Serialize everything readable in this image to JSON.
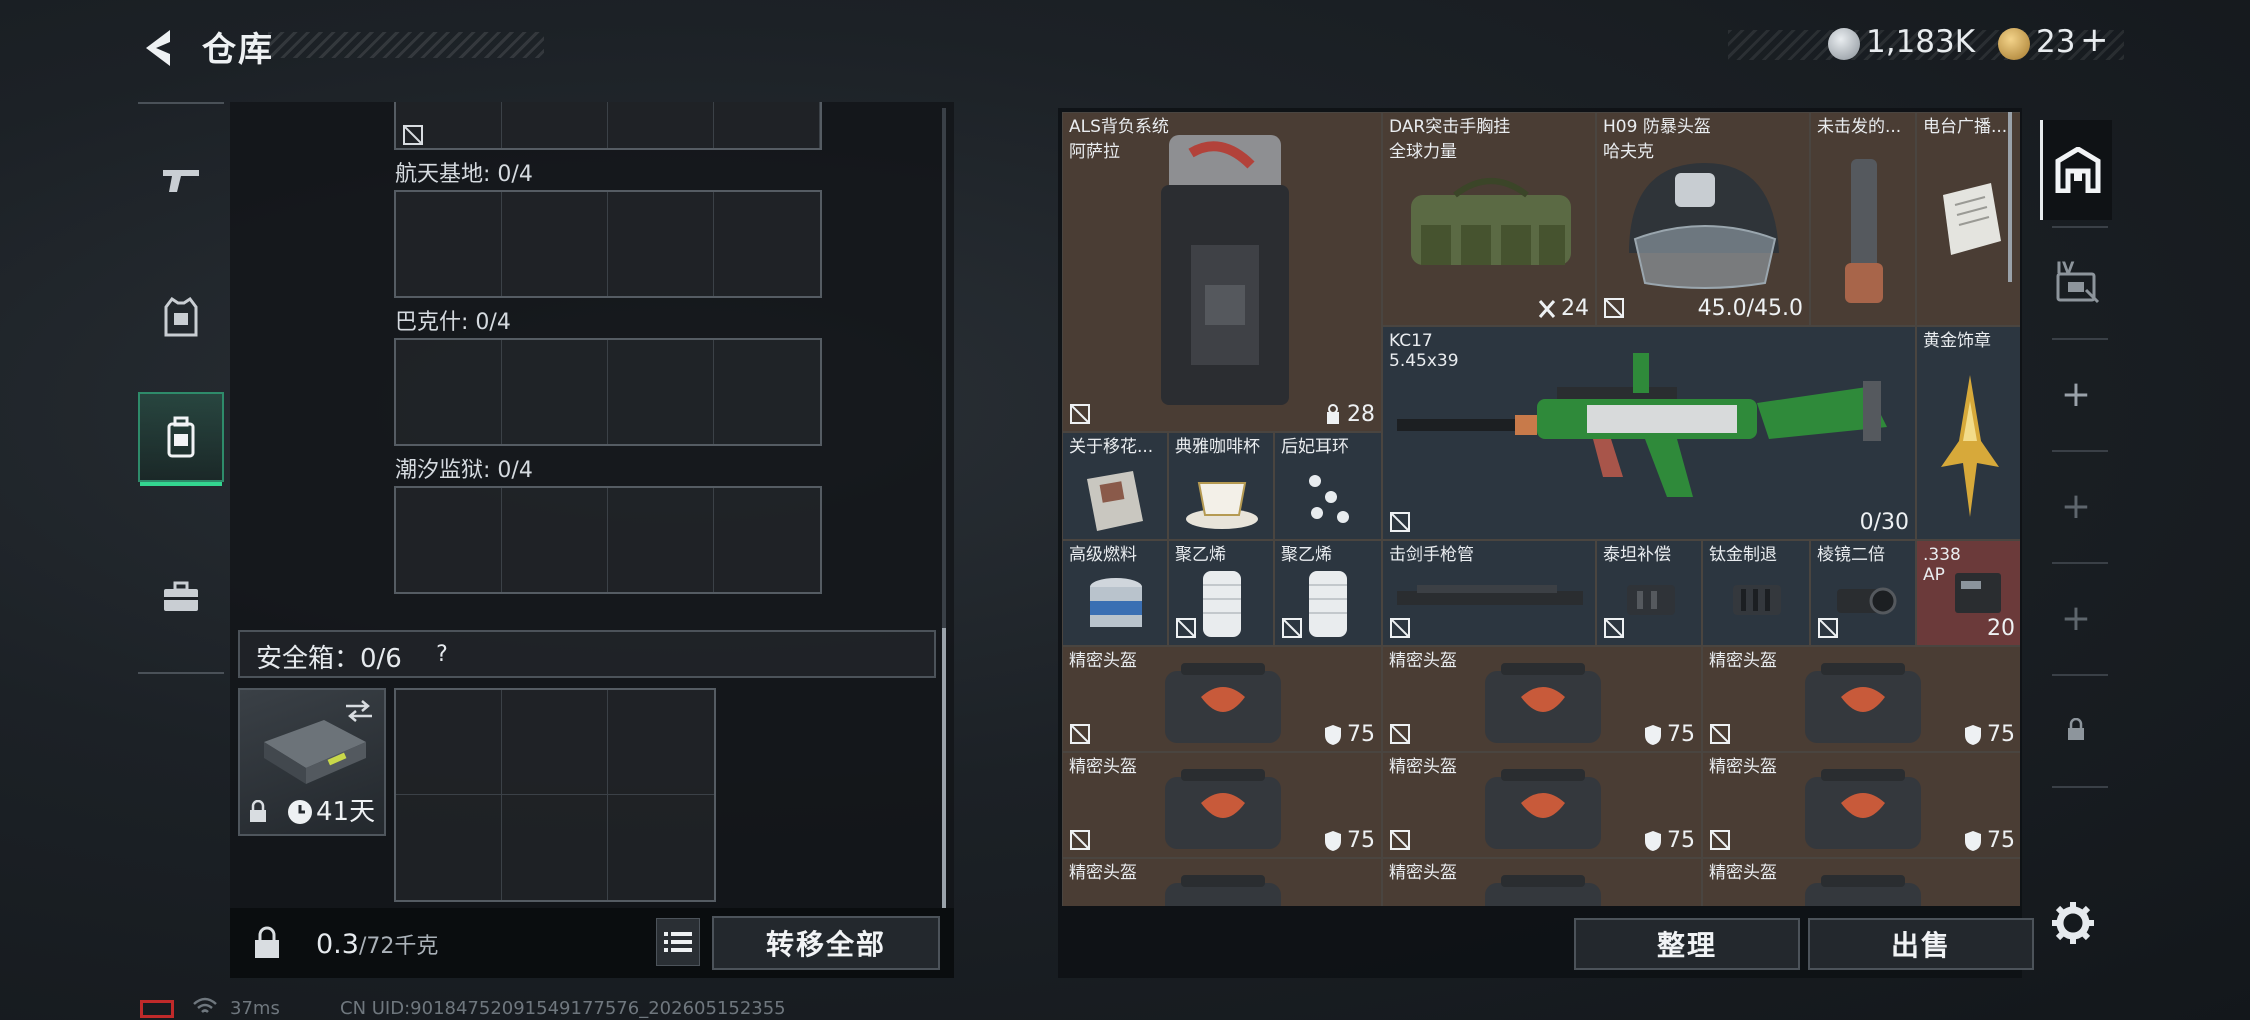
{
  "header": {
    "title": "仓库"
  },
  "currency": {
    "coin_value": "1,183K",
    "ticket_value": "23",
    "ticket_plus": "+"
  },
  "left_nav": [
    {
      "icon": "pistol-icon"
    },
    {
      "icon": "vest-icon"
    },
    {
      "icon": "backpack-icon",
      "active": true
    },
    {
      "icon": "briefcase-icon"
    }
  ],
  "map_slots": [
    {
      "label": "航天基地: 0/4"
    },
    {
      "label": "巴克什: 0/4"
    },
    {
      "label": "潮汐监狱: 0/4"
    }
  ],
  "safebox": {
    "label": "安全箱：0/6",
    "help": "?",
    "duration": "41天"
  },
  "footer_left": {
    "weight_current": "0.3",
    "weight_max": "/72千克",
    "transfer_all": "转移全部"
  },
  "footer_right": {
    "sort": "整理",
    "sell": "出售"
  },
  "stash_items": [
    {
      "name": "ALS背负系统",
      "sub": "阿萨拉",
      "count": "28"
    },
    {
      "name": "DAR突击手胸挂",
      "sub": "全球力量",
      "count": "24"
    },
    {
      "name": "H09 防暴头盔",
      "sub": "哈夫克",
      "count": "45.0/45.0"
    },
    {
      "name": "未击发的..."
    },
    {
      "name": "电台广播..."
    },
    {
      "name": "KC17",
      "sub": "5.45x39",
      "count": "0/30"
    },
    {
      "name": "黄金饰章"
    },
    {
      "name": "关于移花..."
    },
    {
      "name": "典雅咖啡杯"
    },
    {
      "name": "后妃耳环"
    },
    {
      "name": "高级燃料"
    },
    {
      "name": "聚乙烯"
    },
    {
      "name": "聚乙烯"
    },
    {
      "name": "击剑手枪管"
    },
    {
      "name": "泰坦补偿"
    },
    {
      "name": "钛金制退"
    },
    {
      "name": "棱镜二倍"
    },
    {
      "name": ".338",
      "sub": "AP",
      "count": "20"
    },
    {
      "name": "精密头盔",
      "count": "75"
    },
    {
      "name": "精密头盔",
      "count": "75"
    },
    {
      "name": "精密头盔",
      "count": "75"
    },
    {
      "name": "精密头盔",
      "count": "75"
    },
    {
      "name": "精密头盔",
      "count": "75"
    },
    {
      "name": "精密头盔",
      "count": "75"
    },
    {
      "name": "精密头盔"
    },
    {
      "name": "精密头盔"
    },
    {
      "name": "精密头盔"
    }
  ],
  "right_tabs": [
    {
      "icon": "stash-icon",
      "active": true
    },
    {
      "icon": "stash-iv-icon",
      "label": "IV"
    },
    {
      "icon": "plus-icon",
      "label": "+"
    },
    {
      "icon": "plus-icon",
      "label": "+"
    },
    {
      "icon": "plus-icon",
      "label": "+"
    },
    {
      "icon": "lock-icon"
    }
  ],
  "status_bar": {
    "ping": "37ms",
    "uid": "CN UID:90184752091549177576_202605152355"
  },
  "colors": {
    "accent_green": "#33d690",
    "item_brown": "#4a3d34",
    "item_blue": "#2c3640",
    "item_red": "#6b3a3a"
  }
}
